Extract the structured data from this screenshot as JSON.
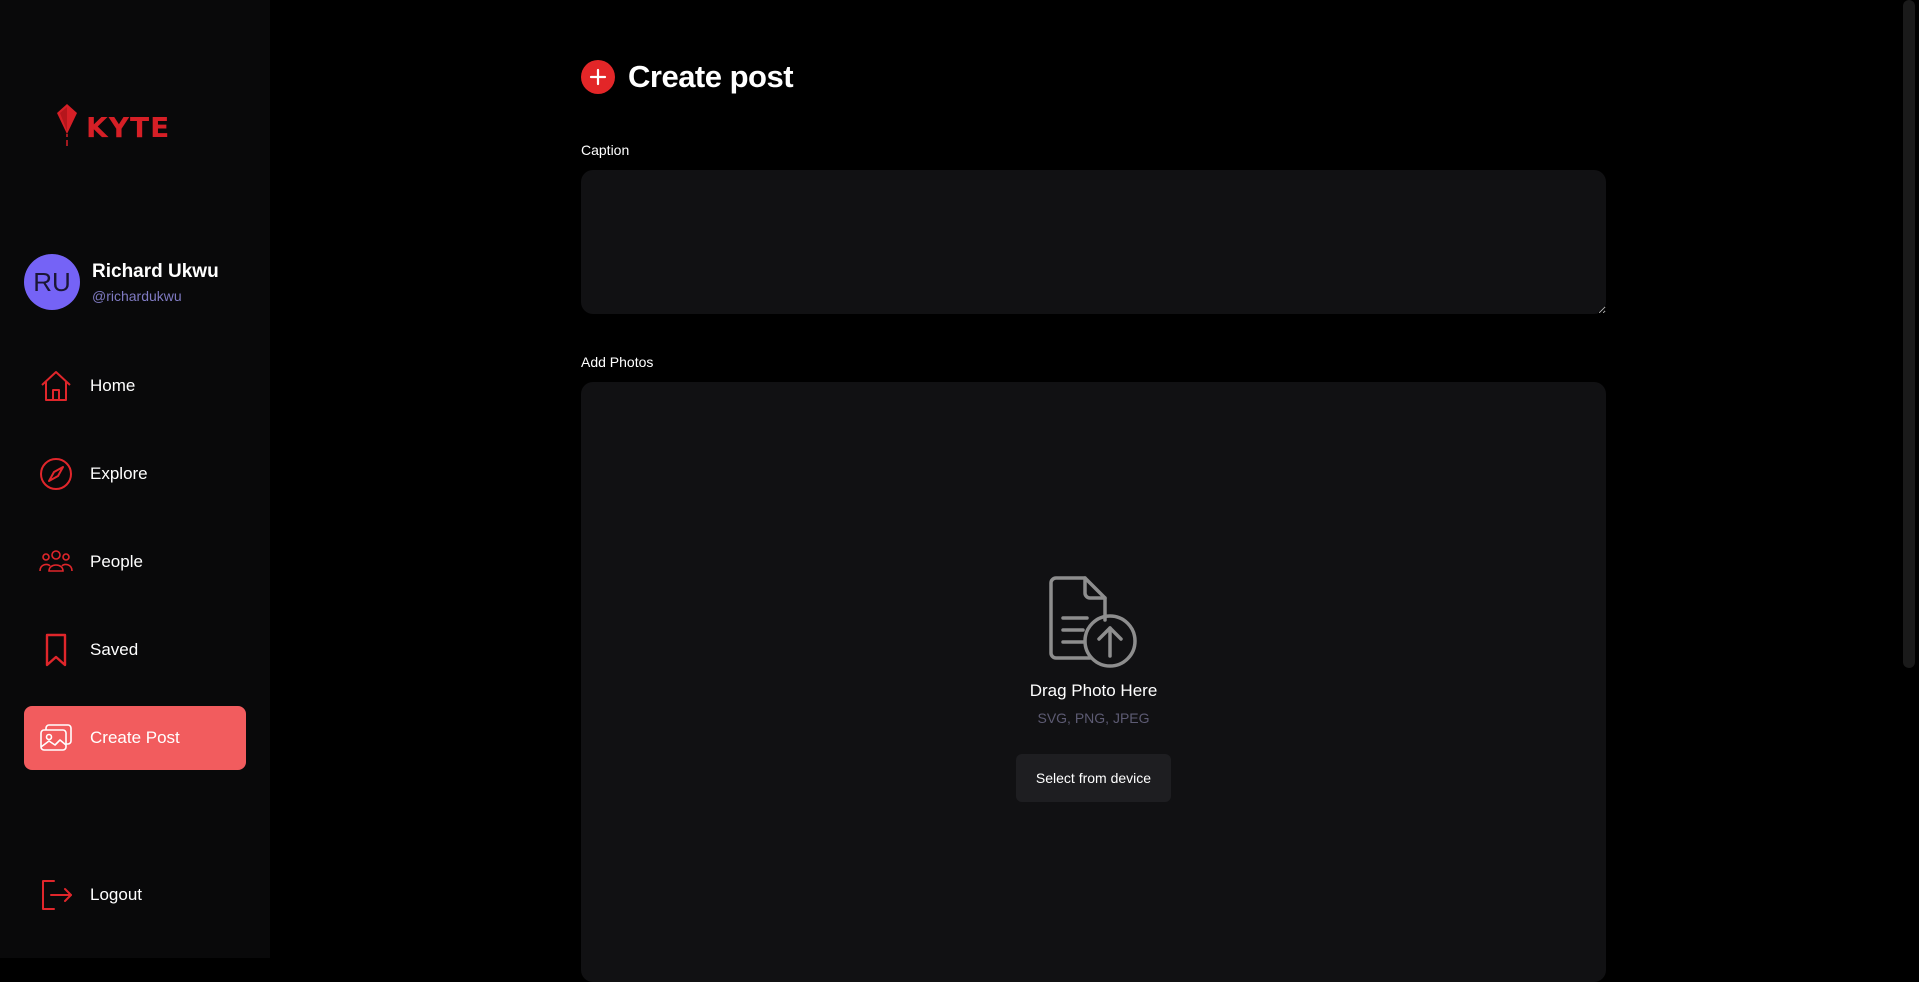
{
  "brand": {
    "name": "KYTE",
    "color": "#d61f26"
  },
  "user": {
    "initials": "RU",
    "name": "Richard Ukwu",
    "handle": "@richardukwu"
  },
  "nav": {
    "items": [
      {
        "label": "Home",
        "icon": "home-icon"
      },
      {
        "label": "Explore",
        "icon": "compass-icon"
      },
      {
        "label": "People",
        "icon": "people-icon"
      },
      {
        "label": "Saved",
        "icon": "bookmark-icon"
      },
      {
        "label": "Create Post",
        "icon": "gallery-add-icon",
        "active": true
      }
    ],
    "logout_label": "Logout"
  },
  "page": {
    "title": "Create post",
    "caption_label": "Caption",
    "caption_value": "",
    "photos_label": "Add Photos",
    "upload": {
      "drag_text": "Drag Photo Here",
      "formats": "SVG, PNG, JPEG",
      "button_label": "Select from device",
      "icon": "file-upload-icon"
    }
  },
  "colors": {
    "accent": "#e32628",
    "active_nav": "#f25c5e",
    "avatar": "#7563f6"
  }
}
